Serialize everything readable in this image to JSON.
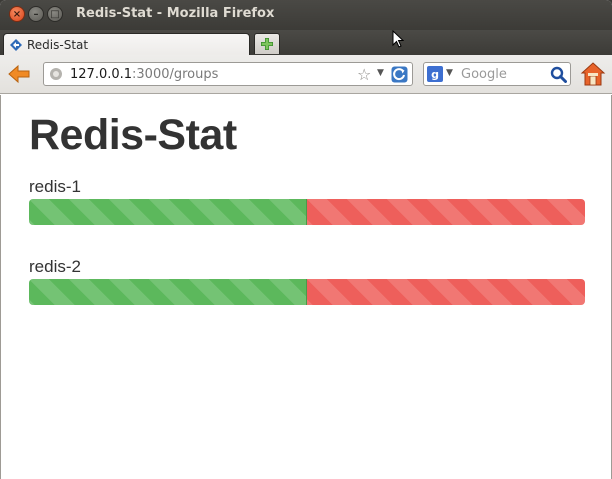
{
  "window": {
    "title": "Redis-Stat - Mozilla Firefox",
    "close_glyph": "×",
    "minimize_glyph": "–",
    "maximize_glyph": "□"
  },
  "tabs": [
    {
      "label": "Redis-Stat",
      "icon": "redis-stat-favicon",
      "active": true
    }
  ],
  "navbar": {
    "url_host": "127.0.0.1",
    "url_path": ":3000/groups",
    "search_placeholder": "Google",
    "search_engine_glyph": "g",
    "search_engine": "google-icon"
  },
  "page": {
    "title": "Redis-Stat",
    "groups": [
      {
        "label": "redis-1",
        "ok_fraction": 0.5,
        "fail_fraction": 0.5
      },
      {
        "label": "redis-2",
        "ok_fraction": 0.5,
        "fail_fraction": 0.5
      }
    ]
  },
  "colors": {
    "ok": "#5cb85c",
    "fail": "#ee5f5b",
    "heading": "#333333"
  }
}
